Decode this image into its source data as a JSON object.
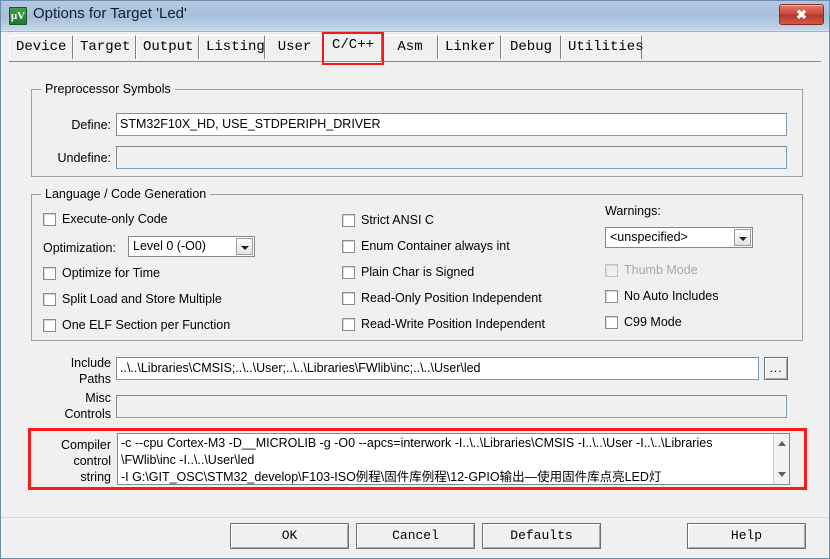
{
  "window": {
    "title": "Options for Target 'Led'",
    "app_icon": "uvision-icon",
    "close_label": "✖"
  },
  "tabs": [
    {
      "label": "Device",
      "selected": false
    },
    {
      "label": "Target",
      "selected": false
    },
    {
      "label": "Output",
      "selected": false
    },
    {
      "label": "Listing",
      "selected": false
    },
    {
      "label": "User",
      "selected": false
    },
    {
      "label": "C/C++",
      "selected": true
    },
    {
      "label": "Asm",
      "selected": false
    },
    {
      "label": "Linker",
      "selected": false
    },
    {
      "label": "Debug",
      "selected": false
    },
    {
      "label": "Utilities",
      "selected": false
    }
  ],
  "preprocessor": {
    "group_title": "Preprocessor Symbols",
    "define_label": "Define:",
    "define_value": "STM32F10X_HD, USE_STDPERIPH_DRIVER",
    "undefine_label": "Undefine:",
    "undefine_value": ""
  },
  "language": {
    "group_title": "Language / Code Generation",
    "left_column": [
      {
        "label": "Execute-only Code",
        "checked": false,
        "enabled": true
      },
      {
        "label": "Optimize for Time",
        "checked": false,
        "enabled": true
      },
      {
        "label": "Split Load and Store Multiple",
        "checked": false,
        "enabled": true
      },
      {
        "label": "One ELF Section per Function",
        "checked": false,
        "enabled": true
      }
    ],
    "optimization_label": "Optimization:",
    "optimization_value": "Level 0 (-O0)",
    "middle_column": [
      {
        "label": "Strict ANSI C",
        "checked": false,
        "enabled": true
      },
      {
        "label": "Enum Container always int",
        "checked": false,
        "enabled": true
      },
      {
        "label": "Plain Char is Signed",
        "checked": false,
        "enabled": true
      },
      {
        "label": "Read-Only Position Independent",
        "checked": false,
        "enabled": true
      },
      {
        "label": "Read-Write Position Independent",
        "checked": false,
        "enabled": true
      }
    ],
    "warnings_label": "Warnings:",
    "warnings_value": "<unspecified>",
    "right_column": [
      {
        "label": "Thumb Mode",
        "checked": false,
        "enabled": false
      },
      {
        "label": "No Auto Includes",
        "checked": false,
        "enabled": true
      },
      {
        "label": "C99 Mode",
        "checked": false,
        "enabled": true
      }
    ]
  },
  "paths": {
    "include_label_line1": "Include",
    "include_label_line2": "Paths",
    "include_value": "..\\..\\Libraries\\CMSIS;..\\..\\User;..\\..\\Libraries\\FWlib\\inc;..\\..\\User\\led",
    "browse_label": "...",
    "misc_label_line1": "Misc",
    "misc_label_line2": "Controls",
    "misc_value": ""
  },
  "compiler": {
    "label_line1": "Compiler",
    "label_line2": "control",
    "label_line3": "string",
    "value": "-c --cpu Cortex-M3 -D__MICROLIB -g -O0 --apcs=interwork -I..\\..\\Libraries\\CMSIS -I..\\..\\User -I..\\..\\Libraries\n\\FWlib\\inc -I..\\..\\User\\led\n-I G:\\GIT_OSC\\STM32_develop\\F103-ISO例程\\固件库例程\\12-GPIO输出—使用固件库点亮LED灯",
    "scroll_up_icon": "scroll-up-arrow",
    "scroll_down_icon": "scroll-down-arrow"
  },
  "buttons": {
    "ok": "OK",
    "cancel": "Cancel",
    "defaults": "Defaults",
    "help": "Help"
  },
  "colors": {
    "highlight_red": "#fb1a1a",
    "dialog_background": "#f0f0f0",
    "title_blue": "#a9c0db",
    "close_red": "#cf4b3c"
  }
}
